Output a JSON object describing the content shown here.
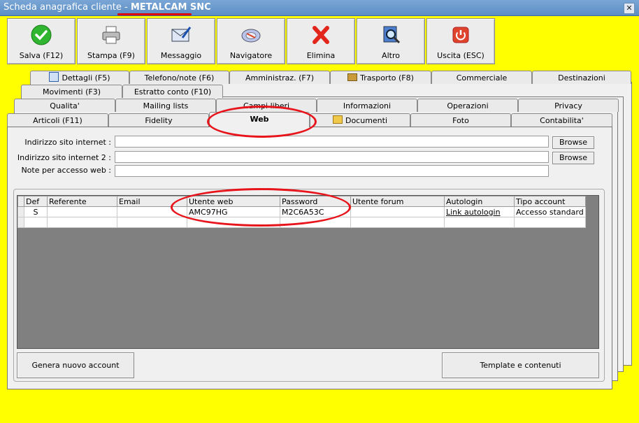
{
  "window": {
    "title_prefix": "Scheda anagrafica cliente - ",
    "title_customer": "METALCAM SNC",
    "close_glyph": "✕"
  },
  "toolbar": [
    {
      "label": "Salva (F12)",
      "icon": "check-icon"
    },
    {
      "label": "Stampa (F9)",
      "icon": "printer-icon"
    },
    {
      "label": "Messaggio",
      "icon": "message-icon"
    },
    {
      "label": "Navigatore",
      "icon": "navigator-icon"
    },
    {
      "label": "Elimina",
      "icon": "delete-icon"
    },
    {
      "label": "Altro",
      "icon": "search-icon"
    },
    {
      "label": "Uscita (ESC)",
      "icon": "power-icon"
    }
  ],
  "tabs": {
    "row1": [
      "Dettagli (F5)",
      "Telefono/note (F6)",
      "Amministraz. (F7)",
      "Trasporto (F8)",
      "Commerciale",
      "Destinazioni"
    ],
    "row2": [
      "Movimenti (F3)",
      "Estratto conto (F10)"
    ],
    "row3": [
      "Qualita'",
      "Mailing lists",
      "Campi liberi",
      "Informazioni",
      "Operazioni",
      "Privacy"
    ],
    "row4": [
      "Articoli (F11)",
      "Fidelity",
      "Web",
      "Documenti",
      "Foto",
      "Contabilita'"
    ],
    "active": "Web"
  },
  "web": {
    "site_label": "Indirizzo sito internet :",
    "site2_label": "Indirizzo sito internet 2 :",
    "notes_label": "Note per accesso web :",
    "site_value": "",
    "site2_value": "",
    "notes_value": "",
    "browse_label": "Browse"
  },
  "grid": {
    "columns": [
      "Def",
      "Referente",
      "Email",
      "Utente web",
      "Password",
      "Utente forum",
      "Autologin",
      "Tipo account"
    ],
    "rows": [
      [
        "S",
        "",
        "",
        "AMC97HG",
        "M2C6A53C",
        "",
        "Link autologin",
        "Accesso standard"
      ],
      [
        "",
        "",
        "",
        "",
        "",
        "",
        "",
        ""
      ]
    ]
  },
  "footer": {
    "new_account": "Genera nuovo account",
    "templates": "Template e contenuti"
  },
  "colors": {
    "background": "#FFFF00",
    "highlight": "#E8141B"
  }
}
